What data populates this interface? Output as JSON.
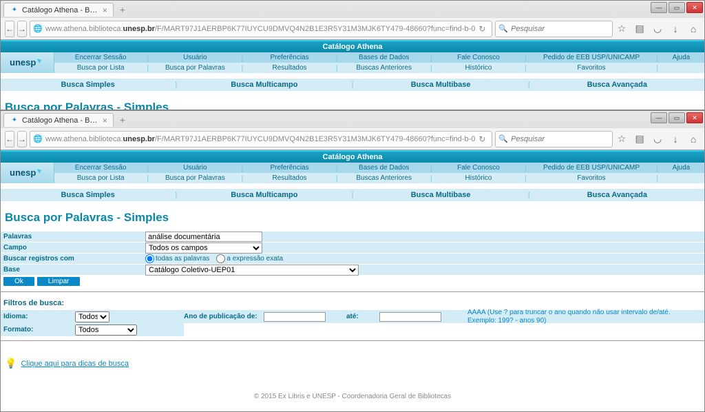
{
  "tab": {
    "title": "Catálogo Athena - Busca Si..."
  },
  "url": {
    "prefix": "www.athena.biblioteca.",
    "bold": "unesp.br",
    "suffix": "/F/MART97J1AERBP6K77IUYCU9DMVQ4N2B1E3R5Y31M3MJK6TY479-48660?func=find-b-0"
  },
  "search_placeholder": "Pesquisar",
  "header_title": "Catálogo Athena",
  "logo_text": "unesp",
  "nav_row1": [
    "Encerrar Sessão",
    "Usuário",
    "Preferências",
    "Bases de Dados",
    "Fale Conosco",
    "Pedido de EEB USP/UNICAMP",
    "Ajuda"
  ],
  "nav_row2": [
    "Busca por Lista",
    "Busca por Palavras",
    "Resultados",
    "Buscas Anteriores",
    "Histórico",
    "Favoritos",
    ""
  ],
  "sub_nav": [
    "Busca Simples",
    "Busca Multicampo",
    "Busca Multibase",
    "Busca Avançada"
  ],
  "page_title": "Busca por Palavras - Simples",
  "form": {
    "palavras_label": "Palavras",
    "palavras_value": "análise documentária",
    "campo_label": "Campo",
    "campo_value": "Todos os campos",
    "registros_label": "Buscar registros com",
    "radio1": "todas as palavras",
    "radio2": "a expressão exata",
    "base_label": "Base",
    "base_value": "Catálogo Coletivo-UEP01",
    "ok": "Ok",
    "limpar": "Limpar"
  },
  "filters": {
    "heading": "Filtros de busca:",
    "idioma_label": "Idioma:",
    "idioma_value": "Todos",
    "formato_label": "Formato:",
    "formato_value": "Todos",
    "ano_de": "Ano de publicação de:",
    "ate": "até:",
    "hint1": "AAAA (Use ? para truncar o ano quando não usar intervalo de/até.",
    "hint2": "Exemplo: 199? - anos 90)"
  },
  "tips_link": "Clique aqui para dicas de busca",
  "footer": "© 2015 Ex Libris e UNESP - Coordenadoria Geral de Bibliotecas"
}
